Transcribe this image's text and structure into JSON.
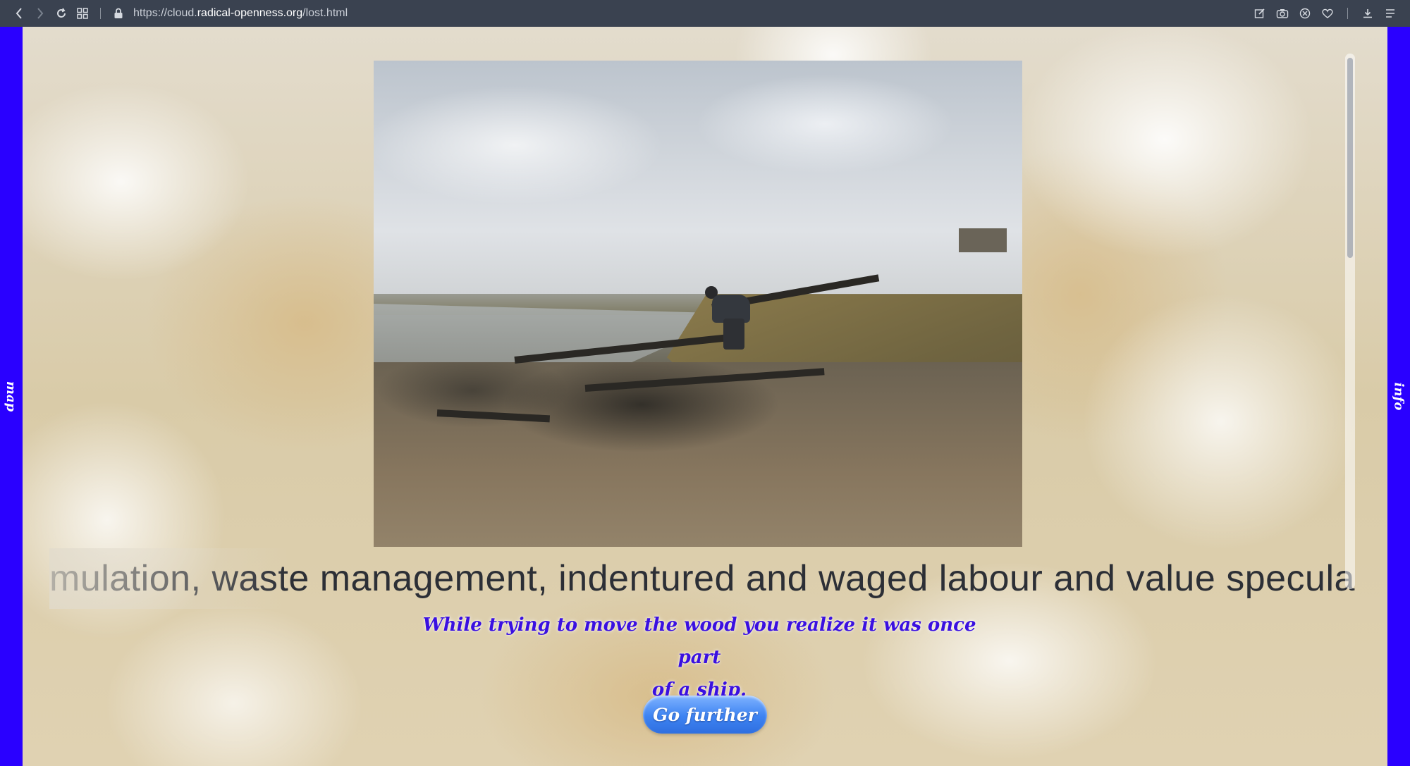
{
  "browser": {
    "url_prefix": "https://cloud.",
    "url_host": "radical-openness.org",
    "url_path": "/lost.html",
    "icons": {
      "back": "chevron-left-icon",
      "forward": "chevron-right-icon",
      "reload": "reload-icon",
      "tabs": "grid-icon",
      "lock": "lock-icon",
      "edit": "edit-icon",
      "camera": "camera-icon",
      "shield": "shield-icon",
      "heart": "heart-icon",
      "download": "download-icon",
      "menu": "menu-icon"
    }
  },
  "rails": {
    "left_label": "map",
    "right_label": "info",
    "color": "#2a00ff"
  },
  "main": {
    "photo_alt": "",
    "marquee": "mulation, waste management, indentured and waged labour and value specula",
    "caption_line1": "While trying to move the wood you realize it was once part",
    "caption_line2": "of a ship.",
    "button_label": "Go further",
    "caption_color": "#3a10e0",
    "button_color": "#3d83f2"
  }
}
